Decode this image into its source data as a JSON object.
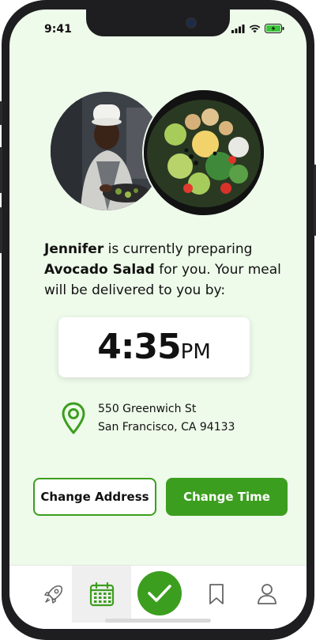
{
  "status_bar": {
    "time": "9:41"
  },
  "order": {
    "preparer": "Jennifer",
    "text_1": " is currently preparing ",
    "dish": "Avocado Salad",
    "text_2": " for you. Your meal will be delivered to you by:"
  },
  "delivery": {
    "time": "4:35",
    "ampm": "PM"
  },
  "address": {
    "line1": "550 Greenwich St",
    "line2": "San Francisco, CA 94133"
  },
  "actions": {
    "change_address": "Change Address",
    "change_time": "Change Time"
  },
  "tabs": [
    {
      "icon": "rocket-icon",
      "active": false
    },
    {
      "icon": "calendar-icon",
      "active": true
    },
    {
      "icon": "check-icon",
      "active": false
    },
    {
      "icon": "bookmark-icon",
      "active": false
    },
    {
      "icon": "profile-icon",
      "active": false
    }
  ],
  "colors": {
    "accent": "#3c9e1f",
    "background": "#eefaea"
  }
}
